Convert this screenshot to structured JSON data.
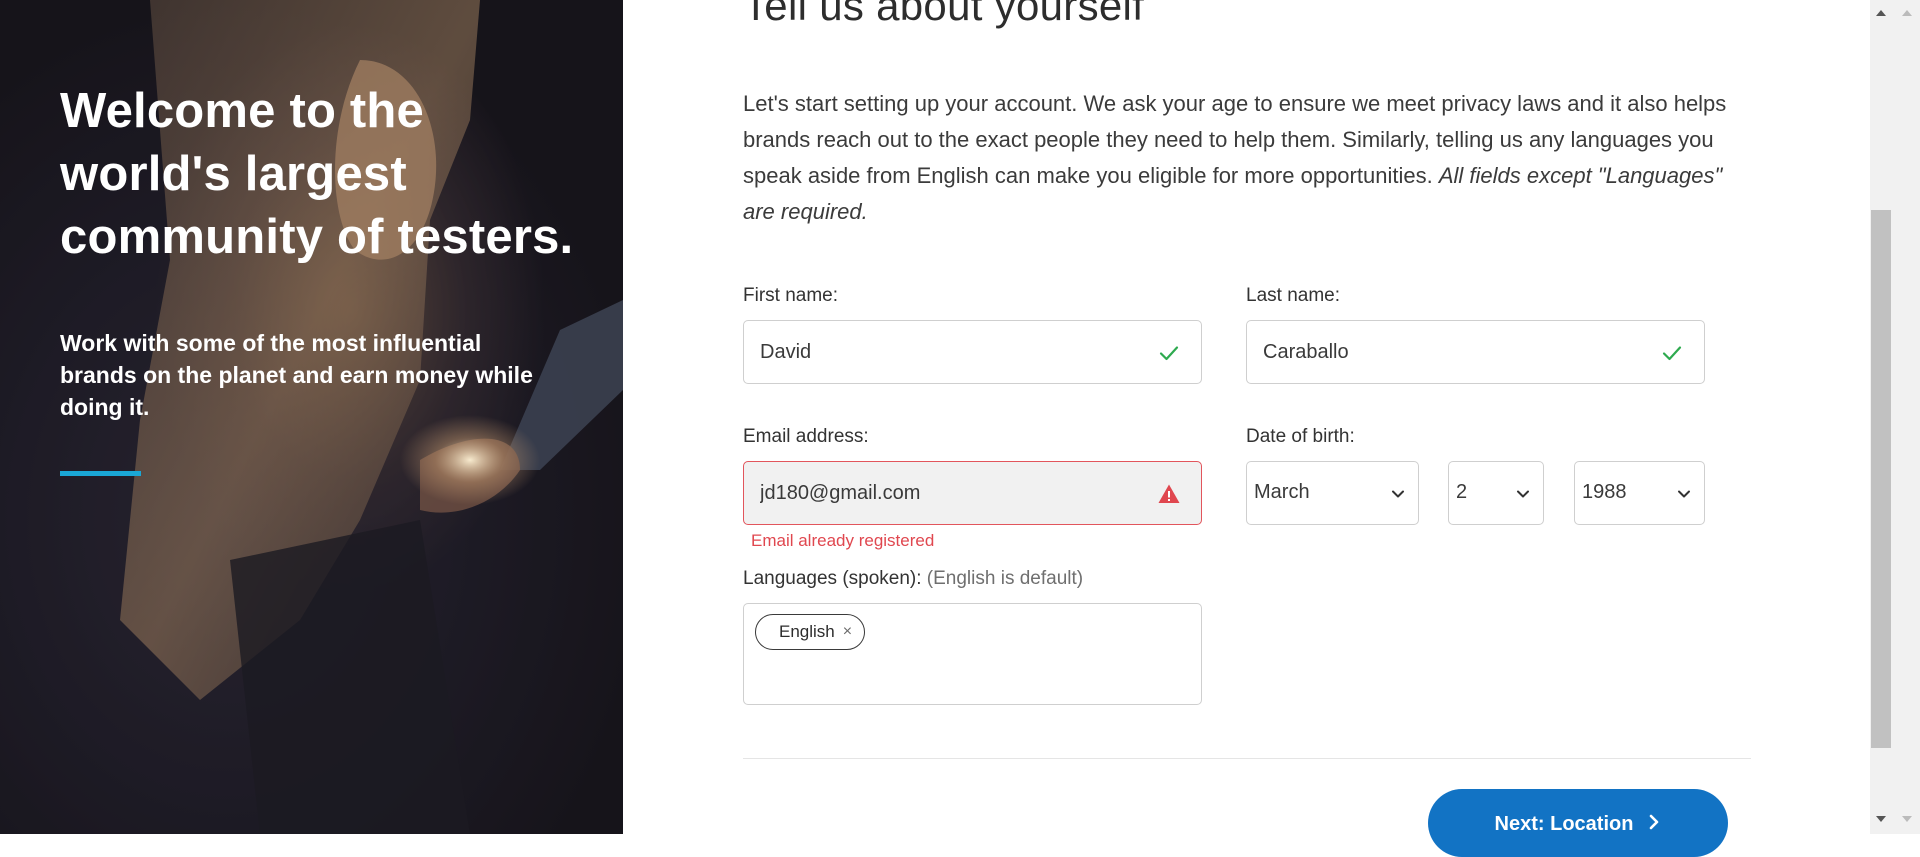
{
  "hero": {
    "title": "Welcome to the world's largest community of testers.",
    "subtitle": "Work with some of the most influential brands on the planet and earn money while doing it.",
    "accent_color": "#1aa7d6"
  },
  "form": {
    "heading": "Tell us about yourself",
    "intro": "Let's start setting up your account. We ask your age to ensure we meet privacy laws and it also helps brands reach out to the exact people they need to help them. Similarly, telling us any languages you speak aside from English can make you eligible for more opportunities.",
    "intro_note": "All fields except \"Languages\" are required.",
    "first_name": {
      "label": "First name:",
      "value": "David",
      "status_icon": "check-icon"
    },
    "last_name": {
      "label": "Last name:",
      "value": "Caraballo",
      "status_icon": "check-icon"
    },
    "email": {
      "label": "Email address:",
      "value": "jd180@gmail.com",
      "status_icon": "warning-icon",
      "error": "Email already registered"
    },
    "dob": {
      "label": "Date of birth:",
      "month": "March",
      "day": "2",
      "year": "1988"
    },
    "languages": {
      "label": "Languages (spoken):",
      "hint": "(English is default)",
      "chips": [
        "English"
      ],
      "remove_glyph": "×"
    },
    "next_button": "Next: Location",
    "colors": {
      "success": "#2eaa4f",
      "error": "#e0474f",
      "primary_button": "#1273c4"
    }
  }
}
